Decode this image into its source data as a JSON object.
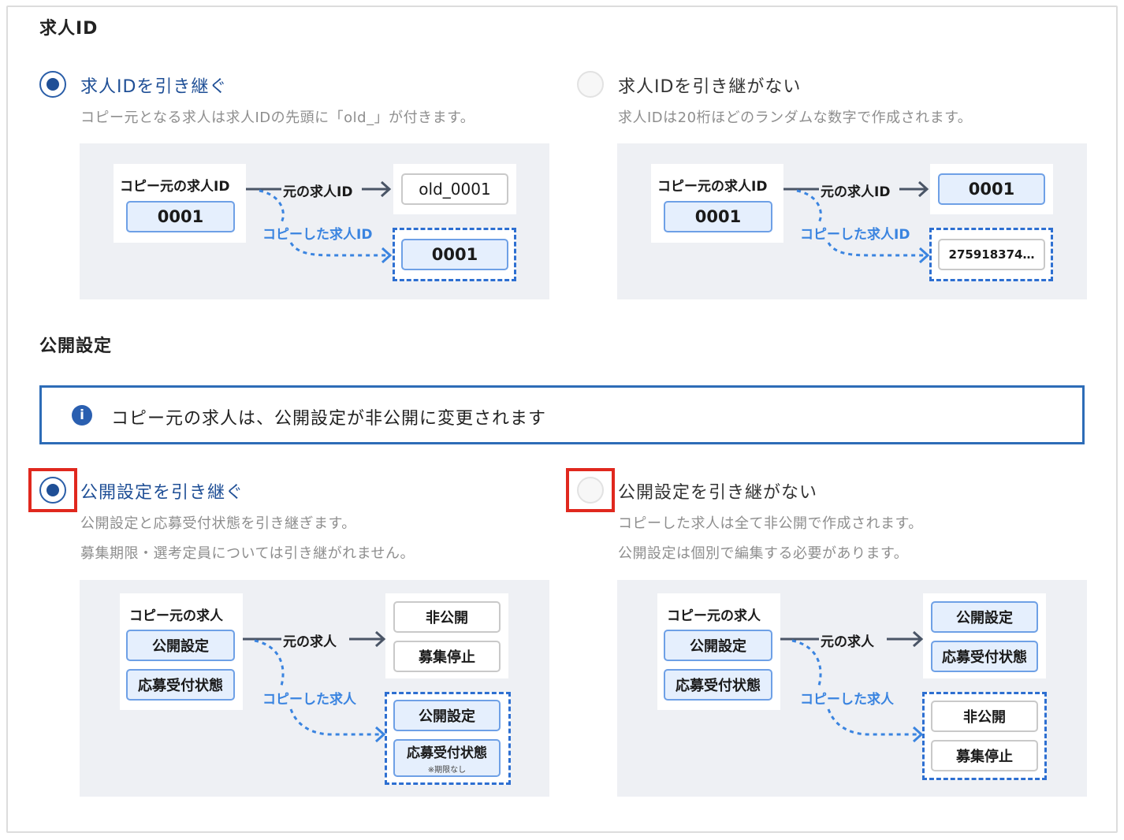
{
  "job_id_section": {
    "title": "求人ID",
    "inherit": {
      "label": "求人IDを引き継ぐ",
      "desc": "コピー元となる求人は求人IDの先頭に「old_」が付きます。",
      "diagram": {
        "source_title": "コピー元の求人ID",
        "source_value": "0001",
        "original_arrow": "元の求人ID",
        "original_value": "old_0001",
        "copy_arrow": "コピーした求人ID",
        "copy_value": "0001"
      }
    },
    "not_inherit": {
      "label": "求人IDを引き継がない",
      "desc": "求人IDは20桁ほどのランダムな数字で作成されます。",
      "diagram": {
        "source_title": "コピー元の求人ID",
        "source_value": "0001",
        "original_arrow": "元の求人ID",
        "original_value": "0001",
        "copy_arrow": "コピーした求人ID",
        "copy_value": "275918374…"
      }
    }
  },
  "publish_section": {
    "title": "公開設定",
    "info_message": "コピー元の求人は、公開設定が非公開に変更されます",
    "inherit": {
      "label": "公開設定を引き継ぐ",
      "desc_1": "公開設定と応募受付状態を引き継ぎます。",
      "desc_2": "募集期限・選考定員については引き継がれません。",
      "diagram": {
        "source_title": "コピー元の求人",
        "source_box_1": "公開設定",
        "source_box_2": "応募受付状態",
        "original_arrow": "元の求人",
        "original_box_1": "非公開",
        "original_box_2": "募集停止",
        "copy_arrow": "コピーした求人",
        "copy_box_1": "公開設定",
        "copy_box_2": "応募受付状態",
        "copy_box_2_note": "※期限なし"
      }
    },
    "not_inherit": {
      "label": "公開設定を引き継がない",
      "desc_1": "コピーした求人は全て非公開で作成されます。",
      "desc_2": "公開設定は個別で編集する必要があります。",
      "diagram": {
        "source_title": "コピー元の求人",
        "source_box_1": "公開設定",
        "source_box_2": "応募受付状態",
        "original_arrow": "元の求人",
        "original_box_1": "公開設定",
        "original_box_2": "応募受付状態",
        "copy_arrow": "コピーした求人",
        "copy_box_1": "非公開",
        "copy_box_2": "募集停止"
      }
    }
  },
  "colors": {
    "accent": "#1f4f96",
    "highlight": "#e0281e",
    "copy_blue": "#3a84e0",
    "diagram_bg": "#eef0f4"
  }
}
